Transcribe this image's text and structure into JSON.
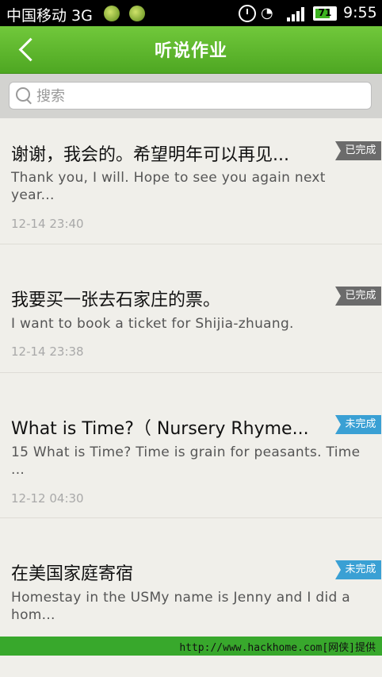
{
  "status_bar": {
    "carrier": "中国移动 3G",
    "battery": "71",
    "time": "9:55",
    "icons": [
      "app-notification-icon",
      "app-notification-icon-2",
      "alarm-icon",
      "wifi-icon",
      "signal-icon",
      "battery-icon"
    ]
  },
  "header": {
    "title": "听说作业",
    "back_icon": "chevron-left-icon"
  },
  "search": {
    "placeholder": "搜索",
    "icon": "search-icon"
  },
  "items": [
    {
      "title": "谢谢，我会的。希望明年可以再见...",
      "desc": "Thank you, I will. Hope to see you again next year...",
      "time": "12-14 23:40",
      "status": "已完成"
    },
    {
      "title": "我要买一张去石家庄的票。",
      "desc": "I want to book a ticket for Shijia-zhuang.",
      "time": "12-14 23:38",
      "status": "已完成"
    },
    {
      "title": "What is Time?（ Nursery Rhyme...",
      "desc": "15 What is Time? Time is grain for peasants. Time ...",
      "time": "12-12 04:30",
      "status": "未完成"
    },
    {
      "title": "在美国家庭寄宿",
      "desc": "Homestay in the USMy name is Jenny and I did a hom...",
      "time": "",
      "status": "未完成"
    }
  ],
  "colors": {
    "header_green": "#5cb62c",
    "badge_done": "#6b6b6b",
    "badge_todo": "#3aa0d4"
  },
  "footer": {
    "watermark": "http://www.hackhome.com[网侠]提供"
  }
}
